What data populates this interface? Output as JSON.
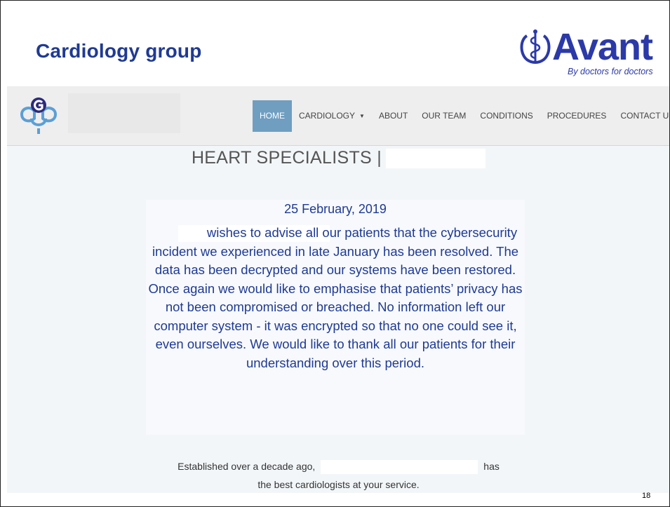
{
  "slide": {
    "title": "Cardiology group",
    "page_number": "18",
    "logo": {
      "wordmark": "Avant",
      "tagline": "By doctors for doctors",
      "emblem_icon": "caduceus-icon",
      "color": "#2b3aa8"
    }
  },
  "website": {
    "brand_icon": "cardiology-cross-logo-icon",
    "nav": {
      "items": [
        {
          "label": "HOME",
          "active": true
        },
        {
          "label": "CARDIOLOGY",
          "dropdown": true
        },
        {
          "label": "ABOUT"
        },
        {
          "label": "OUR TEAM"
        },
        {
          "label": "CONDITIONS"
        },
        {
          "label": "PROCEDURES"
        },
        {
          "label": "CONTACT US"
        }
      ],
      "active_color": "#6f9ec1"
    },
    "heading": "HEART SPECIALISTS |",
    "notice": {
      "date": "25 February, 2019",
      "body": "wishes to advise all our patients that the cybersecurity incident we experienced in late January has been resolved. The data has been decrypted and our systems have been restored. Once again we would like to emphasise that patients’ privacy has not been compromised or breached. No information left our computer system - it was encrypted so that no one could see it, even ourselves. We would like to thank all our patients for their understanding over this period."
    },
    "established": {
      "before": "Established over a decade ago,",
      "after": "has",
      "line2": "the best cardiologists at your service."
    }
  }
}
